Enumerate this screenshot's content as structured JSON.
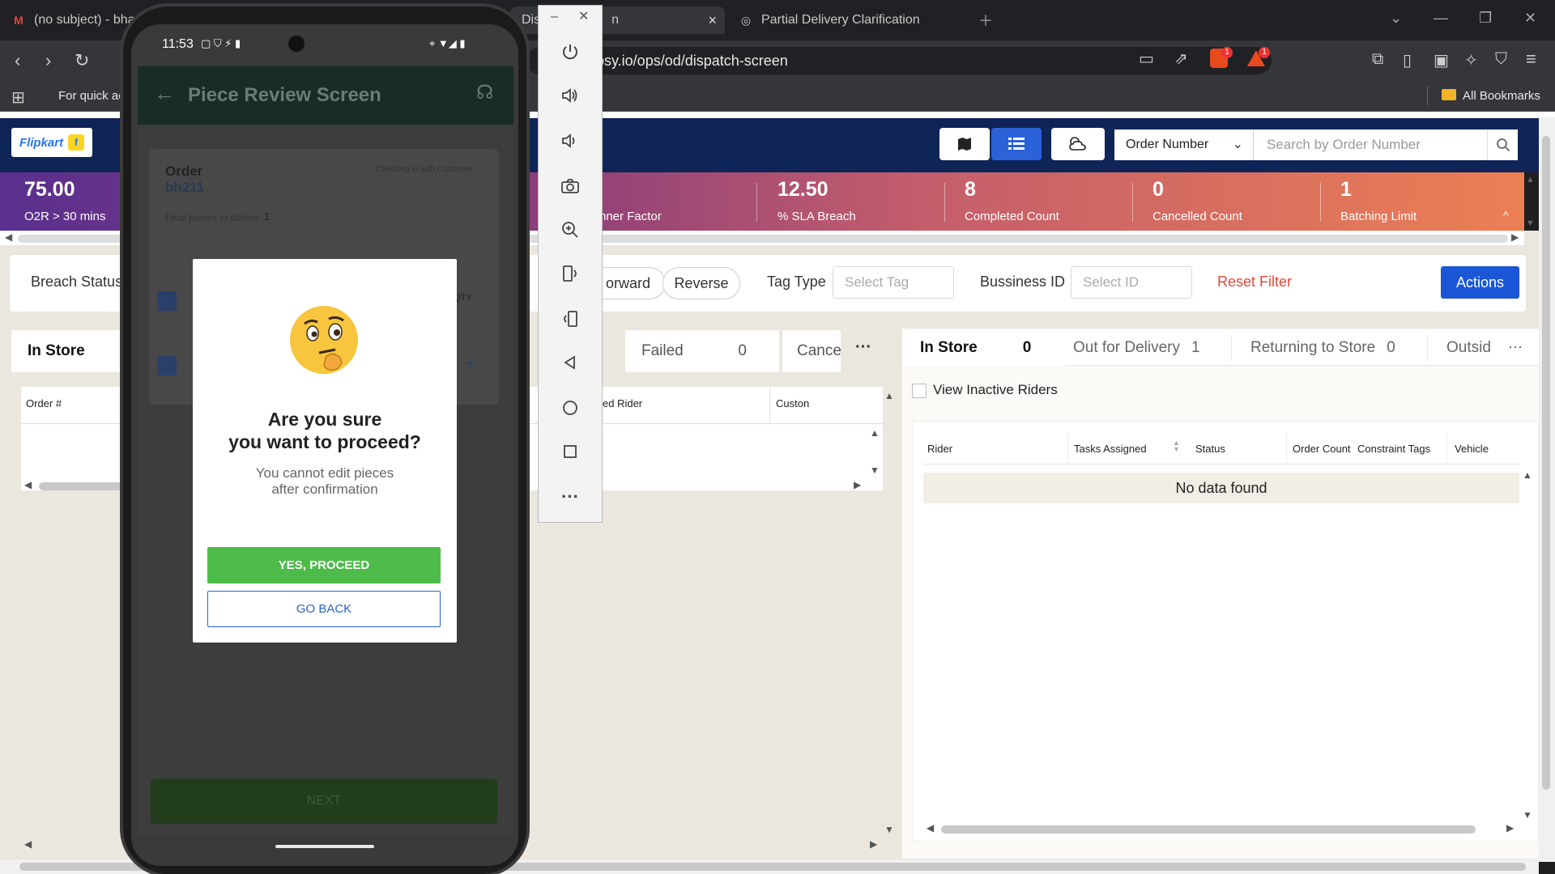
{
  "browser": {
    "tabs": [
      {
        "label": "(no subject) - bha"
      },
      {
        "label": "Dis"
      },
      {
        "label": "n"
      },
      {
        "label": "Partial Delivery Clarification"
      }
    ],
    "url": "ipsy.io/ops/od/dispatch-screen",
    "bookmarks_hint": "For quick ac",
    "all_bookmarks": "All Bookmarks",
    "badge_count_brave": "1",
    "badge_count_alert": "1"
  },
  "header": {
    "logo": "Flipkart",
    "order_select": "Order Number",
    "search_placeholder": "Search by Order Number"
  },
  "metrics": [
    {
      "value": "75.00",
      "label": "O2R > 30 mins"
    },
    {
      "value": "",
      "label": "nner Factor"
    },
    {
      "value": "12.50",
      "label": "% SLA Breach"
    },
    {
      "value": "8",
      "label": "Completed Count"
    },
    {
      "value": "0",
      "label": "Cancelled Count"
    },
    {
      "value": "1",
      "label": "Batching Limit"
    }
  ],
  "filters": {
    "breach_status": "Breach Status",
    "forward": "orward",
    "reverse": "Reverse",
    "tag_type": "Tag Type",
    "tag_placeholder": "Select Tag",
    "business_id": "Bussiness ID",
    "id_placeholder": "Select ID",
    "reset": "Reset Filter",
    "actions": "Actions"
  },
  "orders": {
    "tabs": [
      {
        "label": "In Store"
      },
      {
        "label": "Failed",
        "count": "0"
      },
      {
        "label": "Cance"
      }
    ],
    "more": "···",
    "columns": [
      "Order #",
      "ed Rider",
      "Custon"
    ]
  },
  "riders": {
    "tabs": [
      {
        "label": "In Store",
        "count": "0"
      },
      {
        "label": "Out for Delivery",
        "count": "1"
      },
      {
        "label": "Returning to Store",
        "count": "0"
      },
      {
        "label": "Outsid"
      }
    ],
    "more": "···",
    "view_inactive": "View Inactive Riders",
    "columns": [
      "Rider",
      "Tasks Assigned",
      "Status",
      "Order Count",
      "Constraint Tags",
      "Vehicle"
    ],
    "empty": "No data found"
  },
  "phone": {
    "time": "11:53",
    "app_title": "Piece Review Screen",
    "order_label": "Order",
    "order_id": "bh211",
    "checking_in": "Checking in with Customer",
    "final_pieces": "Final pieces to deliver",
    "final_pieces_count": "1",
    "qty": "QTY",
    "next": "NEXT",
    "dialog": {
      "title_line1": "Are you sure",
      "title_line2": "you want to proceed?",
      "sub_line1": "You cannot edit pieces",
      "sub_line2": "after confirmation",
      "yes": "YES, PROCEED",
      "back": "GO BACK"
    }
  },
  "colors": {
    "header_bg": "#0f2457",
    "accent_blue": "#1a56d6",
    "yes_green": "#4dbb4a",
    "reset_red": "#e2473b"
  }
}
